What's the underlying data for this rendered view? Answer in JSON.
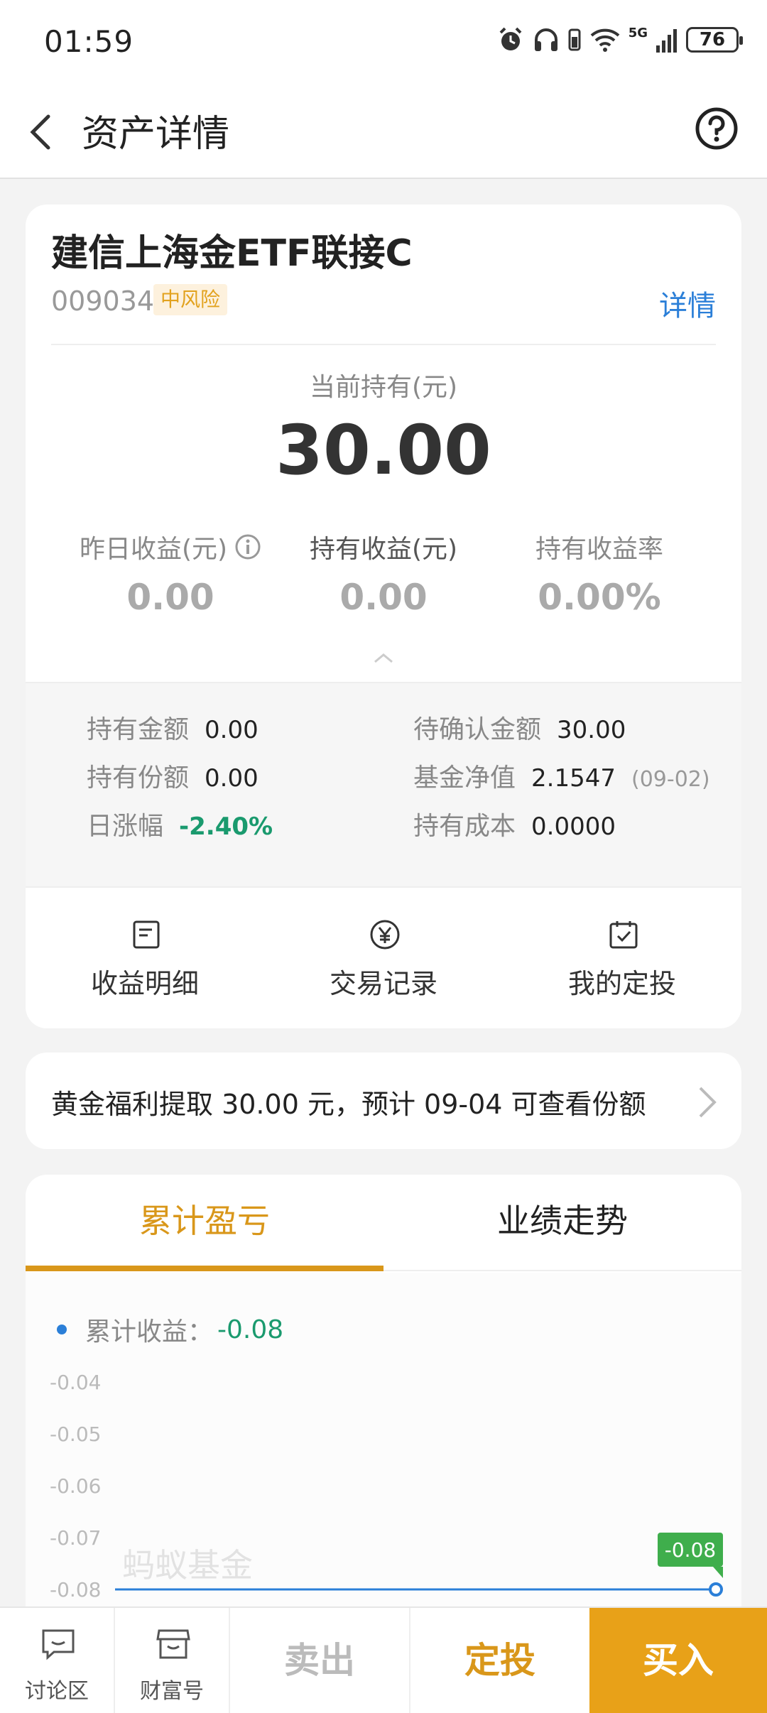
{
  "status_bar": {
    "time": "01:59",
    "network": "5G",
    "battery": "76"
  },
  "nav": {
    "title": "资产详情"
  },
  "fund": {
    "name": "建信上海金ETF联接C",
    "code": "009034",
    "risk": "中风险",
    "detail_link": "详情"
  },
  "holding": {
    "label": "当前持有(元)",
    "value": "30.00"
  },
  "stats": [
    {
      "label": "昨日收益(元)",
      "value": "0.00"
    },
    {
      "label": "持有收益(元)",
      "value": "0.00"
    },
    {
      "label": "持有收益率",
      "value": "0.00%"
    }
  ],
  "details": {
    "hold_amount": {
      "k": "持有金额",
      "v": "0.00"
    },
    "pending_amount": {
      "k": "待确认金额",
      "v": "30.00"
    },
    "hold_shares": {
      "k": "持有份额",
      "v": "0.00"
    },
    "nav_value": {
      "k": "基金净值",
      "v": "2.1547",
      "date": "(09-02)"
    },
    "daily_change": {
      "k": "日涨幅",
      "v": "-2.40%"
    },
    "hold_cost": {
      "k": "持有成本",
      "v": "0.0000"
    }
  },
  "actions": [
    "收益明细",
    "交易记录",
    "我的定投"
  ],
  "notice": {
    "text": "黄金福利提取 30.00 元，预计 09-04 可查看份额"
  },
  "chart_tabs": {
    "active": "累计盈亏",
    "inactive": "业绩走势"
  },
  "chart_data": {
    "type": "line",
    "series": [
      {
        "name": "累计收益",
        "values": [
          -0.08,
          -0.08
        ],
        "color": "#2b7fd8"
      }
    ],
    "legend": {
      "label": "累计收益：",
      "value": "-0.08"
    },
    "y_ticks": [
      "-0.04",
      "-0.05",
      "-0.06",
      "-0.07",
      "-0.08"
    ],
    "ylim": [
      -0.08,
      -0.04
    ],
    "end_label": "-0.08",
    "watermark": "蚂蚁基金"
  },
  "bottom_bar": {
    "discussion": "讨论区",
    "wealth": "财富号",
    "sell": "卖出",
    "dingtou": "定投",
    "buy": "买入"
  }
}
